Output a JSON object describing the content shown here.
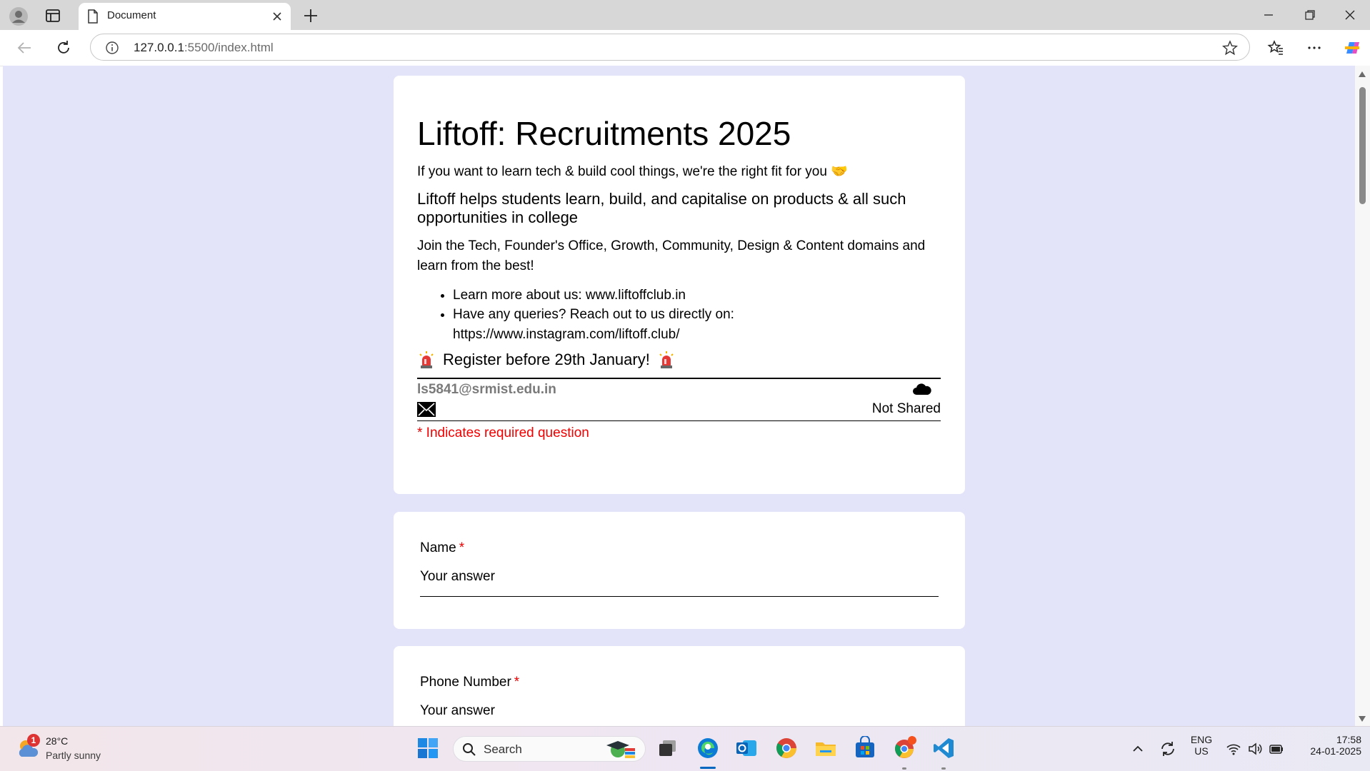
{
  "browser": {
    "tab_title": "Document",
    "url_host": "127.0.0.1",
    "url_rest": ":5500/index.html"
  },
  "form": {
    "title": "Liftoff: Recruitments 2025",
    "tagline": "If you want to learn tech & build cool things, we're the right fit for you",
    "tagline_emoji": "🤝",
    "mission": "Liftoff helps students learn, build, and capitalise on products & all such opportunities in college",
    "domains": "Join the Tech, Founder's Office, Growth, Community, Design & Content domains and learn from the best!",
    "links": [
      "Learn more about us: www.liftoffclub.in",
      "Have any queries? Reach out to us directly on: https://www.instagram.com/liftoff.club/"
    ],
    "register": "Register before 29th January!",
    "account_email": "ls5841@srmist.edu.in",
    "not_shared": "Not Shared",
    "required_note": "* Indicates required question",
    "questions": [
      {
        "label": "Name",
        "required_mark": "*",
        "placeholder": "Your answer"
      },
      {
        "label": "Phone Number",
        "required_mark": "*",
        "placeholder": "Your answer"
      }
    ]
  },
  "taskbar": {
    "weather_badge": "1",
    "temperature": "28°C",
    "condition": "Partly sunny",
    "search_label": "Search",
    "lang": "ENG",
    "region": "US",
    "time": "17:58",
    "date": "24-01-2025"
  }
}
